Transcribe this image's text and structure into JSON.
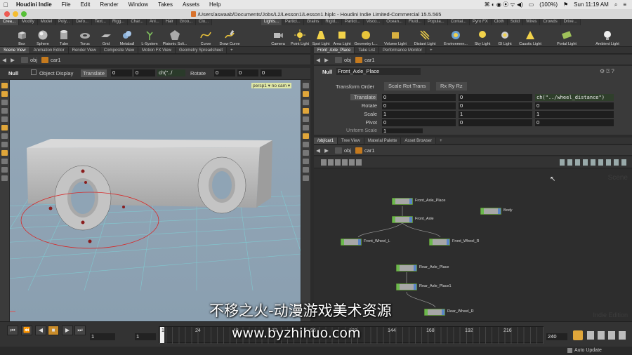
{
  "menubar": {
    "app": "Houdini Indie",
    "items": [
      "File",
      "Edit",
      "Render",
      "Window",
      "Takes",
      "Assets",
      "Help"
    ],
    "clock": "Sun 11:19 AM",
    "battery": "(100%)"
  },
  "window_title": "/Users/aswaab/Documents/Jobs/L2/Lesson1/Lesson1.hiplc - Houdini Indie Limited-Commercial 15.5.565",
  "shelf": {
    "left_tabs": [
      "Crea...",
      "Modify",
      "Model",
      "Poly...",
      "Defo...",
      "Text...",
      "Rigg...",
      "Char...",
      "Ani...",
      "Hair",
      "Groo...",
      "Clo..."
    ],
    "left_tools": [
      "Box",
      "Sphere",
      "Tube",
      "Torus",
      "Grid",
      "Metaball",
      "L-System",
      "Platonic Soli...",
      "Curve",
      "Draw Curve"
    ],
    "right_tabs": [
      "Lights...",
      "Particl...",
      "Grains",
      "Rigid...",
      "Particl...",
      "Visco...",
      "Ocean...",
      "Fluid...",
      "Popula...",
      "Contai...",
      "Pyro FX",
      "Cloth",
      "Solid",
      "Wires",
      "Crowds",
      "Drive..."
    ],
    "right_tools": [
      "Camera",
      "Point Light",
      "Spot Light",
      "Area Light",
      "Geometry L...",
      "Volume Light",
      "Distant Light",
      "Environmen...",
      "Sky Light",
      "GI Light",
      "Caustic Light",
      "Portal Light",
      "Ambient Light"
    ]
  },
  "left_tabs": [
    "Scene View",
    "Animation Editor",
    "Render View",
    "Composite View",
    "Motion FX View",
    "Geometry Spreadsheet"
  ],
  "left_path": {
    "root": "obj",
    "node": "car1"
  },
  "handle_bar": {
    "type": "Null",
    "display": "Object Display",
    "mode": "Translate",
    "tx": "0",
    "ty": "0",
    "tz": "ch(\"../",
    "rot_label": "Rotate",
    "rx": "0",
    "ry": "0",
    "rz": "0"
  },
  "viewport": {
    "camera_label": "persp1 ▾  no cam ▾"
  },
  "right_tabs": [
    "Front_Axle_Place",
    "Take List",
    "Performance Monitor"
  ],
  "right_path": {
    "root": "obj",
    "node": "car1"
  },
  "params": {
    "node_type": "Null",
    "node_name": "Front_Axle_Place",
    "transform_order_label": "Transform Order",
    "transform_order": "Scale Rot Trans",
    "rot_order": "Rx Ry Rz",
    "rows": [
      {
        "label": "Translate",
        "values": [
          "0",
          "0",
          "ch(\"../wheel_distance\")"
        ]
      },
      {
        "label": "Rotate",
        "values": [
          "0",
          "0",
          "0"
        ]
      },
      {
        "label": "Scale",
        "values": [
          "1",
          "1",
          "1"
        ]
      },
      {
        "label": "Pivot",
        "values": [
          "0",
          "0",
          "0"
        ]
      }
    ],
    "uniform_label": "Uniform Scale",
    "uniform_value": "1"
  },
  "net_tabs": [
    "/obj/car1",
    "Tree View",
    "Material Palette",
    "Asset Browser"
  ],
  "net_path": {
    "root": "obj",
    "node": "car1"
  },
  "network": {
    "corner_label": "Scene",
    "footer_label": "Indie Edition",
    "nodes": [
      {
        "name": "Front_Axle_Place"
      },
      {
        "name": "Body"
      },
      {
        "name": "Front_Axle"
      },
      {
        "name": "Front_Wheel_L"
      },
      {
        "name": "Front_Wheel_R"
      },
      {
        "name": "Rear_Axle_Place"
      },
      {
        "name": "Rear_Axle_Place1"
      },
      {
        "name": "Rear_Wheel_R"
      }
    ]
  },
  "timeline": {
    "ticks": [
      "1",
      "24",
      "48",
      "72",
      "96",
      "120",
      "144",
      "168",
      "192",
      "216"
    ],
    "current_frame": "1",
    "start_frame": "1",
    "end_frame": "240",
    "auto_update": "Auto Update"
  },
  "watermark": {
    "line1": "不移之火-动漫游戏美术资源",
    "line2": "www.byzhihuo.com"
  }
}
